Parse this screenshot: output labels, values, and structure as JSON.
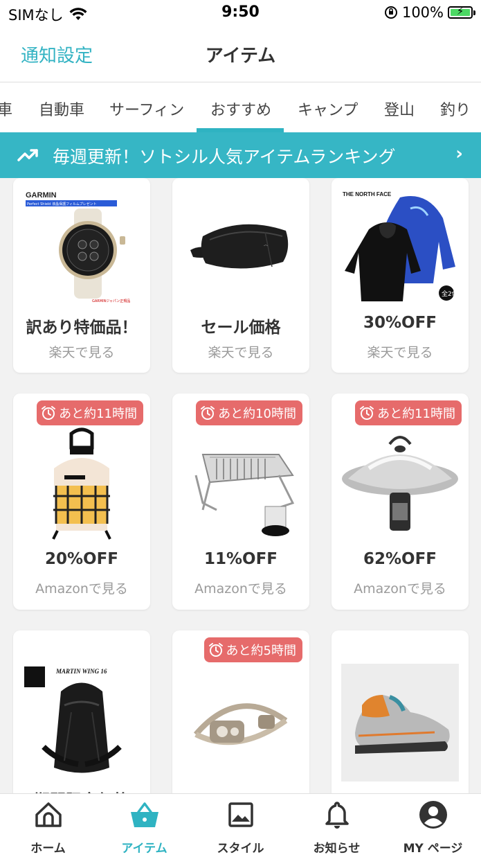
{
  "status_bar": {
    "carrier": "SIMなし",
    "time": "9:50",
    "battery": "100%"
  },
  "nav": {
    "left": "通知設定",
    "title": "アイテム"
  },
  "category_tabs": [
    "車",
    "自動車",
    "サーフィン",
    "おすすめ",
    "キャンプ",
    "登山",
    "釣り"
  ],
  "active_tab": "おすすめ",
  "banner": {
    "text": "毎週更新！ソトシル人気アイテムランキング"
  },
  "products": [
    {
      "title": "訳あり特価品！",
      "link": "楽天で見る",
      "image": "smartwatch",
      "image_text": "GARMIN",
      "image_text2": "Perfect Shield 液晶保護フィルムプレゼント",
      "image_text3": "GARMINジャパン正規品"
    },
    {
      "title": "セール価格",
      "link": "楽天で見る",
      "image": "waist-bag"
    },
    {
      "title": "30%OFF",
      "link": "楽天で見る",
      "image": "rain-jackets",
      "image_text": "THE NORTH FACE",
      "image_text2": "全2色"
    },
    {
      "title": "20%OFF",
      "link": "Amazonで見る",
      "image": "lantern",
      "badge": "あと約11時間"
    },
    {
      "title": "11%OFF",
      "link": "Amazonで見る",
      "image": "bbq-grill",
      "badge": "あと約10時間"
    },
    {
      "title": "62%OFF",
      "link": "Amazonで見る",
      "image": "lamp-shade",
      "badge": "あと約11時間"
    },
    {
      "title": "期間限定価格",
      "link": "",
      "image": "backpack",
      "image_text": "MARTIN WING 16"
    },
    {
      "title": "",
      "link": "",
      "image": "headlamp",
      "badge": "あと約5時間"
    },
    {
      "title": "",
      "link": "",
      "image": "hiking-shoe"
    }
  ],
  "tab_bar": [
    {
      "label": "ホーム",
      "icon": "home-icon"
    },
    {
      "label": "アイテム",
      "icon": "basket-icon",
      "active": true
    },
    {
      "label": "スタイル",
      "icon": "image-icon"
    },
    {
      "label": "お知らせ",
      "icon": "bell-icon"
    },
    {
      "label": "MY ページ",
      "icon": "user-icon"
    }
  ],
  "colors": {
    "accent": "#36b6c5",
    "badge": "#e66b6b",
    "link_gray": "#9a9a9a"
  }
}
